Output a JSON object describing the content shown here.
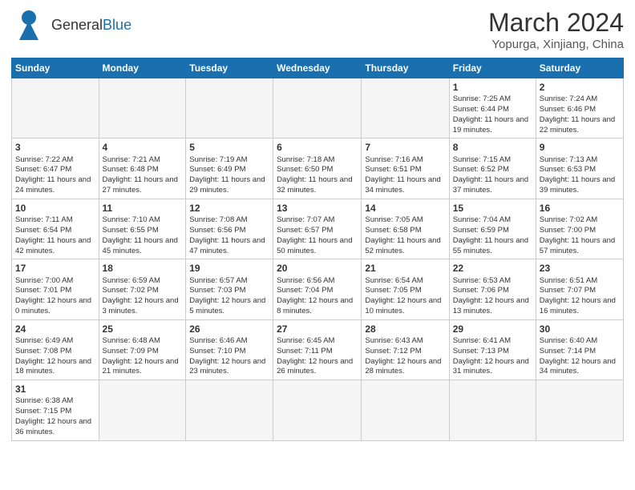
{
  "header": {
    "logo_general": "General",
    "logo_blue": "Blue",
    "month_year": "March 2024",
    "location": "Yopurga, Xinjiang, China"
  },
  "days_of_week": [
    "Sunday",
    "Monday",
    "Tuesday",
    "Wednesday",
    "Thursday",
    "Friday",
    "Saturday"
  ],
  "weeks": [
    [
      {
        "day": "",
        "info": ""
      },
      {
        "day": "",
        "info": ""
      },
      {
        "day": "",
        "info": ""
      },
      {
        "day": "",
        "info": ""
      },
      {
        "day": "",
        "info": ""
      },
      {
        "day": "1",
        "info": "Sunrise: 7:25 AM\nSunset: 6:44 PM\nDaylight: 11 hours and 19 minutes."
      },
      {
        "day": "2",
        "info": "Sunrise: 7:24 AM\nSunset: 6:46 PM\nDaylight: 11 hours and 22 minutes."
      }
    ],
    [
      {
        "day": "3",
        "info": "Sunrise: 7:22 AM\nSunset: 6:47 PM\nDaylight: 11 hours and 24 minutes."
      },
      {
        "day": "4",
        "info": "Sunrise: 7:21 AM\nSunset: 6:48 PM\nDaylight: 11 hours and 27 minutes."
      },
      {
        "day": "5",
        "info": "Sunrise: 7:19 AM\nSunset: 6:49 PM\nDaylight: 11 hours and 29 minutes."
      },
      {
        "day": "6",
        "info": "Sunrise: 7:18 AM\nSunset: 6:50 PM\nDaylight: 11 hours and 32 minutes."
      },
      {
        "day": "7",
        "info": "Sunrise: 7:16 AM\nSunset: 6:51 PM\nDaylight: 11 hours and 34 minutes."
      },
      {
        "day": "8",
        "info": "Sunrise: 7:15 AM\nSunset: 6:52 PM\nDaylight: 11 hours and 37 minutes."
      },
      {
        "day": "9",
        "info": "Sunrise: 7:13 AM\nSunset: 6:53 PM\nDaylight: 11 hours and 39 minutes."
      }
    ],
    [
      {
        "day": "10",
        "info": "Sunrise: 7:11 AM\nSunset: 6:54 PM\nDaylight: 11 hours and 42 minutes."
      },
      {
        "day": "11",
        "info": "Sunrise: 7:10 AM\nSunset: 6:55 PM\nDaylight: 11 hours and 45 minutes."
      },
      {
        "day": "12",
        "info": "Sunrise: 7:08 AM\nSunset: 6:56 PM\nDaylight: 11 hours and 47 minutes."
      },
      {
        "day": "13",
        "info": "Sunrise: 7:07 AM\nSunset: 6:57 PM\nDaylight: 11 hours and 50 minutes."
      },
      {
        "day": "14",
        "info": "Sunrise: 7:05 AM\nSunset: 6:58 PM\nDaylight: 11 hours and 52 minutes."
      },
      {
        "day": "15",
        "info": "Sunrise: 7:04 AM\nSunset: 6:59 PM\nDaylight: 11 hours and 55 minutes."
      },
      {
        "day": "16",
        "info": "Sunrise: 7:02 AM\nSunset: 7:00 PM\nDaylight: 11 hours and 57 minutes."
      }
    ],
    [
      {
        "day": "17",
        "info": "Sunrise: 7:00 AM\nSunset: 7:01 PM\nDaylight: 12 hours and 0 minutes."
      },
      {
        "day": "18",
        "info": "Sunrise: 6:59 AM\nSunset: 7:02 PM\nDaylight: 12 hours and 3 minutes."
      },
      {
        "day": "19",
        "info": "Sunrise: 6:57 AM\nSunset: 7:03 PM\nDaylight: 12 hours and 5 minutes."
      },
      {
        "day": "20",
        "info": "Sunrise: 6:56 AM\nSunset: 7:04 PM\nDaylight: 12 hours and 8 minutes."
      },
      {
        "day": "21",
        "info": "Sunrise: 6:54 AM\nSunset: 7:05 PM\nDaylight: 12 hours and 10 minutes."
      },
      {
        "day": "22",
        "info": "Sunrise: 6:53 AM\nSunset: 7:06 PM\nDaylight: 12 hours and 13 minutes."
      },
      {
        "day": "23",
        "info": "Sunrise: 6:51 AM\nSunset: 7:07 PM\nDaylight: 12 hours and 16 minutes."
      }
    ],
    [
      {
        "day": "24",
        "info": "Sunrise: 6:49 AM\nSunset: 7:08 PM\nDaylight: 12 hours and 18 minutes."
      },
      {
        "day": "25",
        "info": "Sunrise: 6:48 AM\nSunset: 7:09 PM\nDaylight: 12 hours and 21 minutes."
      },
      {
        "day": "26",
        "info": "Sunrise: 6:46 AM\nSunset: 7:10 PM\nDaylight: 12 hours and 23 minutes."
      },
      {
        "day": "27",
        "info": "Sunrise: 6:45 AM\nSunset: 7:11 PM\nDaylight: 12 hours and 26 minutes."
      },
      {
        "day": "28",
        "info": "Sunrise: 6:43 AM\nSunset: 7:12 PM\nDaylight: 12 hours and 28 minutes."
      },
      {
        "day": "29",
        "info": "Sunrise: 6:41 AM\nSunset: 7:13 PM\nDaylight: 12 hours and 31 minutes."
      },
      {
        "day": "30",
        "info": "Sunrise: 6:40 AM\nSunset: 7:14 PM\nDaylight: 12 hours and 34 minutes."
      }
    ],
    [
      {
        "day": "31",
        "info": "Sunrise: 6:38 AM\nSunset: 7:15 PM\nDaylight: 12 hours and 36 minutes."
      },
      {
        "day": "",
        "info": ""
      },
      {
        "day": "",
        "info": ""
      },
      {
        "day": "",
        "info": ""
      },
      {
        "day": "",
        "info": ""
      },
      {
        "day": "",
        "info": ""
      },
      {
        "day": "",
        "info": ""
      }
    ]
  ]
}
